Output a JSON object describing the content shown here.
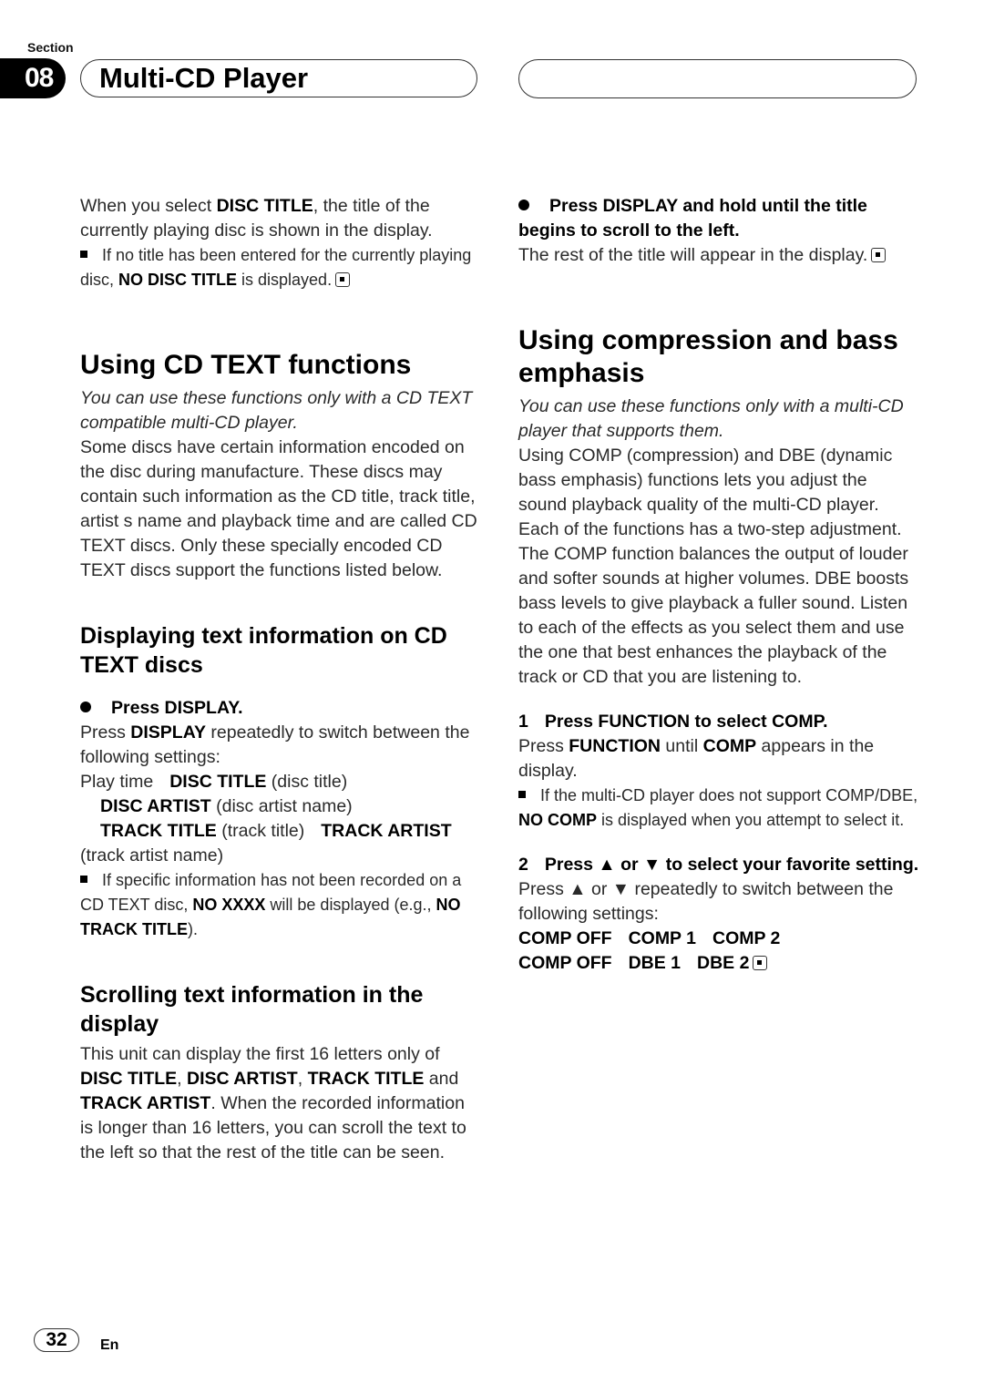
{
  "header": {
    "section_label": "Section",
    "section_number": "08",
    "title": "Multi-CD Player"
  },
  "left": {
    "intro": {
      "p1_a": "When you select ",
      "p1_b": "DISC TITLE",
      "p1_c": ", the title of the currently playing disc is shown in the display.",
      "note_a": "If no title has been entered for the currently playing disc, ",
      "note_b": "NO DISC TITLE",
      "note_c": " is displayed."
    },
    "cdtext": {
      "heading": "Using CD TEXT functions",
      "italic": "You can use these functions only with a CD TEXT compatible multi-CD player.",
      "body": "Some discs have certain information encoded on the disc during manufacture. These discs may contain such information as the CD title, track title, artist s name and playback time and are called CD TEXT discs. Only these specially encoded CD TEXT discs support the functions listed below."
    },
    "displaying": {
      "heading": "Displaying text information on CD TEXT discs",
      "step": "Press DISPLAY.",
      "p_a": "Press ",
      "p_b": "DISPLAY",
      "p_c": " repeatedly to switch between the following settings:",
      "cycle": {
        "play_time": "Play time",
        "disc_title": "DISC TITLE",
        "disc_title_desc": " (disc title)",
        "disc_artist": "DISC ARTIST",
        "disc_artist_desc": " (disc artist name)",
        "track_title": "TRACK TITLE",
        "track_title_desc": " (track title)",
        "track_artist": "TRACK ARTIST",
        "track_artist_desc": "(track artist name)"
      },
      "note_a": "If specific information has not been recorded on a CD TEXT disc, ",
      "note_b": "NO XXXX",
      "note_c": " will be displayed (e.g., ",
      "note_d": "NO TRACK TITLE",
      "note_e": ")."
    },
    "scrolling": {
      "heading": "Scrolling text information in the display",
      "p_a": "This unit can display the first 16 letters only of ",
      "disc_title": "DISC TITLE",
      "sep1": ", ",
      "disc_artist": "DISC ARTIST",
      "sep2": ", ",
      "track_title": "TRACK TITLE",
      "and": " and ",
      "track_artist": "TRACK ARTIST",
      "p_b": ". When the recorded information is longer than 16 letters, you can scroll the text to the left so that the rest of the title can be seen."
    }
  },
  "right": {
    "scroll_step": {
      "step": "Press DISPLAY and hold until the title begins to scroll to the left.",
      "body": "The rest of the title will appear in the display."
    },
    "compression": {
      "heading": "Using compression and bass emphasis",
      "italic": "You can use these functions only with a multi-CD player that supports them.",
      "body": "Using COMP (compression) and DBE (dynamic bass emphasis) functions lets you adjust the sound playback quality of the multi-CD player. Each of the functions has a two-step adjustment. The COMP function balances the output of louder and softer sounds at higher volumes. DBE boosts bass levels to give playback a fuller sound. Listen to each of the effects as you select them and use the one that best enhances the playback of the track or CD that you are listening to."
    },
    "step1": {
      "num": "1",
      "title": "Press FUNCTION to select COMP.",
      "p_a": "Press ",
      "p_b": "FUNCTION",
      "p_c": " until ",
      "p_d": "COMP",
      "p_e": " appears in the display.",
      "note_a": "If the multi-CD player does not support COMP/DBE, ",
      "note_b": "NO COMP",
      "note_c": " is displayed when you attempt to select it."
    },
    "step2": {
      "num": "2",
      "title": "Press ▲ or ▼ to select your favorite setting.",
      "body": "Press ▲ or ▼ repeatedly to switch between the following settings:",
      "row1": [
        "COMP OFF",
        "COMP 1",
        "COMP 2"
      ],
      "row2": [
        "COMP OFF",
        "DBE 1",
        "DBE 2"
      ]
    }
  },
  "footer": {
    "page_number": "32",
    "language": "En"
  }
}
